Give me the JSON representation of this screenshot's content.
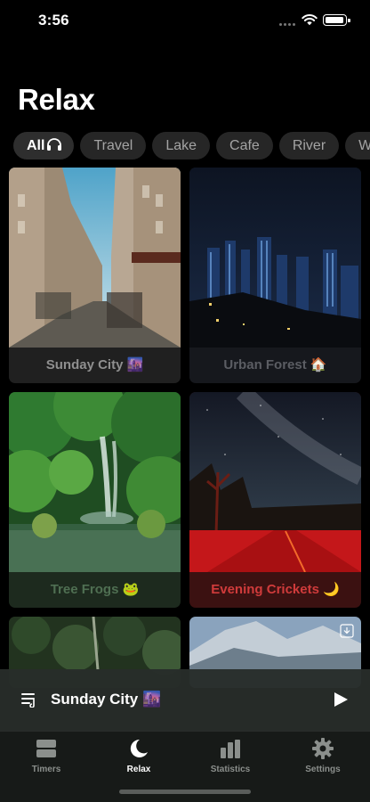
{
  "status": {
    "time": "3:56"
  },
  "page": {
    "title": "Relax"
  },
  "categories": [
    "All",
    "Travel",
    "Lake",
    "Cafe",
    "River",
    "Wat"
  ],
  "cards": [
    {
      "label": "Sunday City 🌆",
      "color": "#8f8f8f"
    },
    {
      "label": "Urban Forest 🏠",
      "color": "#5b5d63"
    },
    {
      "label": "Tree Frogs 🐸",
      "color": "#4f6f52"
    },
    {
      "label": "Evening Crickets 🌙",
      "color": "#d03b3b"
    }
  ],
  "now_playing": {
    "title": "Sunday City 🌆"
  },
  "tabs": [
    {
      "label": "Timers",
      "icon": "timers-icon"
    },
    {
      "label": "Relax",
      "icon": "moon-icon"
    },
    {
      "label": "Statistics",
      "icon": "bar-chart-icon"
    },
    {
      "label": "Settings",
      "icon": "gear-icon"
    }
  ]
}
